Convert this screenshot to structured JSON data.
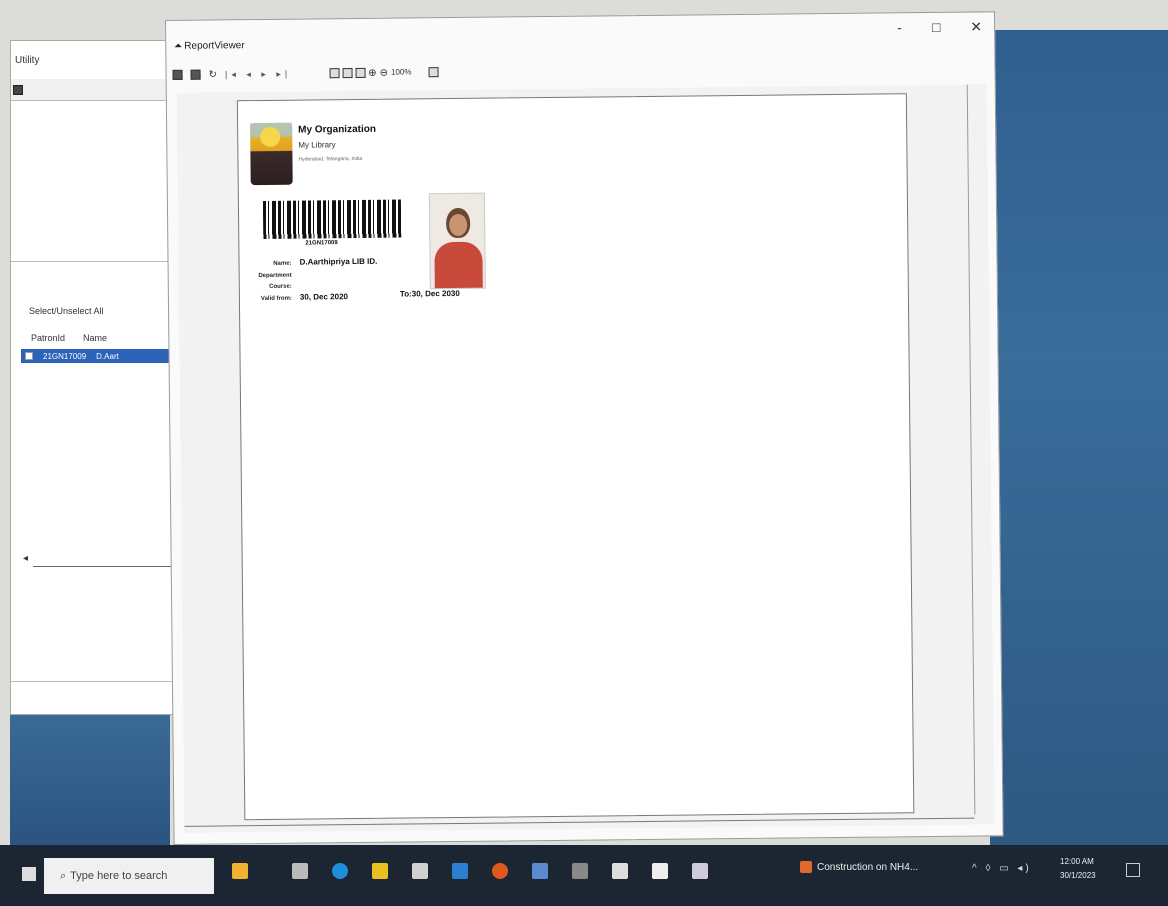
{
  "background_window": {
    "title": "Utility",
    "select_label": "Select/Unselect All",
    "columns": [
      "PatronId",
      "Name"
    ],
    "row": {
      "patron_id": "21GN17009",
      "name": "D.Aart"
    }
  },
  "viewer": {
    "title": "ReportViewer",
    "zoom": "100%",
    "window_controls": [
      "-",
      "□",
      "✕"
    ]
  },
  "card": {
    "org_name": "My Organization",
    "library_name": "My Library",
    "address": "Hyderabad, Telangana, India",
    "barcode_number": "21GN17009",
    "labels": {
      "name": "Name:",
      "department": "Department",
      "course": "Course:",
      "valid_from": "Valid from:"
    },
    "name": "D.Aarthipriya LIB ID.",
    "valid_from": "30, Dec 2020",
    "valid_to": "To:30, Dec 2030"
  },
  "taskbar": {
    "search_placeholder": "Type here to search",
    "news_text": "Construction on NH4...",
    "time": "12:00 AM",
    "date": "30/1/2023"
  },
  "colors": {
    "taskbar": "#1c2633",
    "selection": "#2a63b8",
    "wallpaper": "#2f5f8f"
  }
}
